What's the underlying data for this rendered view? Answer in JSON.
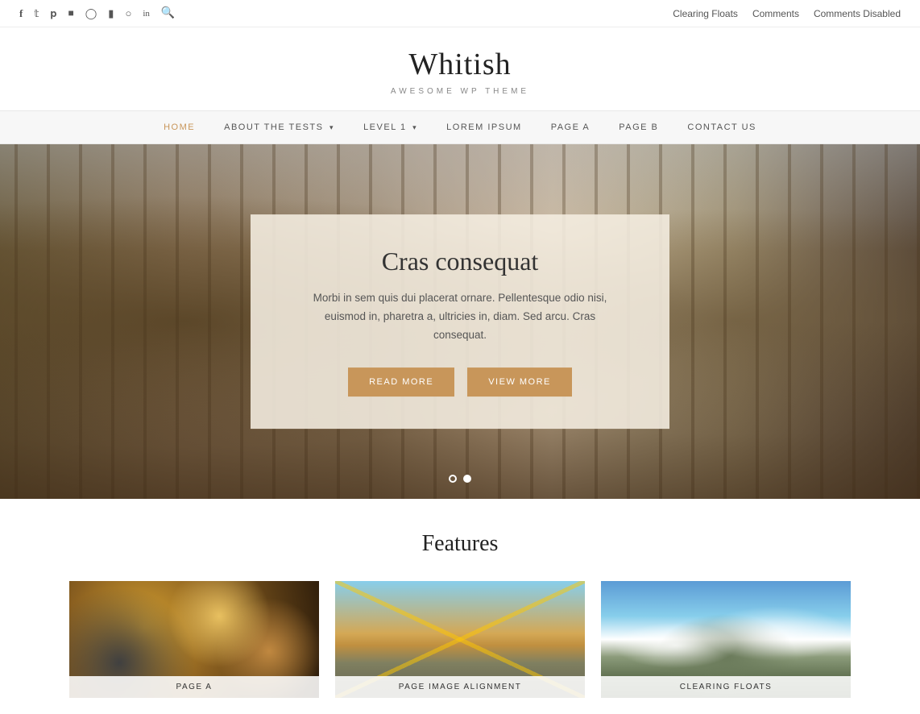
{
  "topBar": {
    "socialIcons": [
      {
        "name": "facebook-icon",
        "symbol": "f"
      },
      {
        "name": "twitter-icon",
        "symbol": "t"
      },
      {
        "name": "pinterest-icon",
        "symbol": "p"
      },
      {
        "name": "behance-icon",
        "symbol": "b"
      },
      {
        "name": "instagram-icon",
        "symbol": "i"
      },
      {
        "name": "houzz-icon",
        "symbol": "h"
      },
      {
        "name": "dribbble-icon",
        "symbol": "d"
      },
      {
        "name": "linkedin-icon",
        "symbol": "in"
      },
      {
        "name": "search-icon",
        "symbol": "🔍"
      }
    ],
    "links": [
      {
        "label": "Clearing Floats",
        "href": "#"
      },
      {
        "label": "Comments",
        "href": "#"
      },
      {
        "label": "Comments Disabled",
        "href": "#"
      }
    ]
  },
  "header": {
    "title": "Whitish",
    "tagline": "Awesome WP Theme"
  },
  "nav": {
    "items": [
      {
        "label": "HOME",
        "href": "#",
        "active": true,
        "hasArrow": false
      },
      {
        "label": "ABOUT THE TESTS",
        "href": "#",
        "active": false,
        "hasArrow": true
      },
      {
        "label": "LEVEL 1",
        "href": "#",
        "active": false,
        "hasArrow": true
      },
      {
        "label": "LOREM IPSUM",
        "href": "#",
        "active": false,
        "hasArrow": false
      },
      {
        "label": "PAGE A",
        "href": "#",
        "active": false,
        "hasArrow": false
      },
      {
        "label": "PAGE B",
        "href": "#",
        "active": false,
        "hasArrow": false
      },
      {
        "label": "CONTACT US",
        "href": "#",
        "active": false,
        "hasArrow": false
      }
    ]
  },
  "hero": {
    "title": "Cras consequat",
    "text": "Morbi in sem quis dui placerat ornare. Pellentesque odio nisi, euismod in, pharetra a, ultricies in, diam. Sed arcu. Cras consequat.",
    "readMoreLabel": "READ MORE",
    "viewMoreLabel": "VIEW MORE",
    "dots": [
      {
        "active": false
      },
      {
        "active": true
      }
    ]
  },
  "features": {
    "title": "Features",
    "cards": [
      {
        "label": "PAGE A",
        "bgClass": "feature-bg-a"
      },
      {
        "label": "PAGE IMAGE ALIGNMENT",
        "bgClass": "feature-bg-b"
      },
      {
        "label": "CLEARING FLOATS",
        "bgClass": "feature-bg-c"
      }
    ]
  }
}
